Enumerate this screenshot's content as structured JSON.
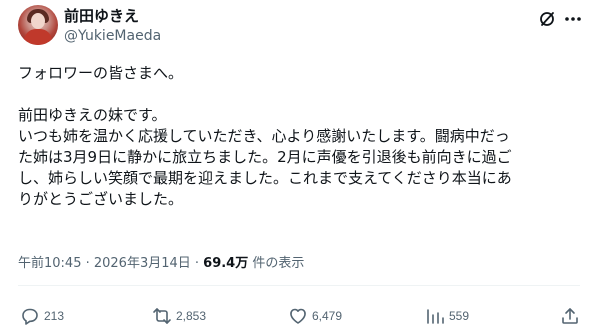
{
  "author": {
    "display_name": "前田ゆきえ",
    "handle": "@YukieMaeda"
  },
  "post": {
    "greeting": "フォロワーの皆さまへ。",
    "paragraph_lines": [
      "前田ゆきえの妹です。",
      "いつも姉を温かく応援していただき、心より感謝いたします。闘病中だっ",
      "た姉は3月9日に静かに旅立ちました。2月に声優を引退後も前向きに過ご",
      "し、姉らしい笑顔で最期を迎えました。これまで支えてくださり本当にあ",
      "りがとうございました。"
    ],
    "timestamp": "午前10:45 · 2026年3月14日 · ",
    "views_count": "69.4万",
    "views_suffix": " 件の表示"
  },
  "actions": {
    "reply_count": "213",
    "repost_count": "2,853",
    "like_count": "6,479",
    "views_count": "559"
  },
  "icons": {
    "grok": "grok-icon",
    "more": "more-icon",
    "reply": "reply-icon",
    "repost": "repost-icon",
    "like": "heart-icon",
    "views": "bar-chart-icon",
    "share": "share-icon"
  },
  "colors": {
    "text": "#0f1419",
    "secondary": "#536471",
    "divider": "#eff3f4"
  }
}
